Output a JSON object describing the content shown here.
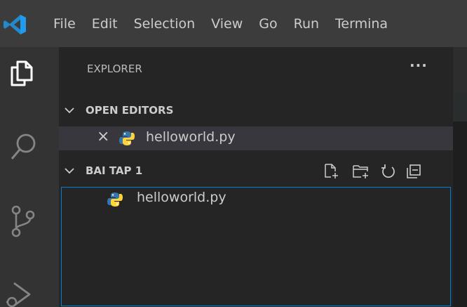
{
  "menu": {
    "items": [
      "File",
      "Edit",
      "Selection",
      "View",
      "Go",
      "Run",
      "Termina"
    ]
  },
  "activity_bar": {
    "icons": [
      "explorer-icon",
      "search-icon",
      "source-control-icon",
      "run-debug-icon"
    ]
  },
  "sidebar": {
    "title": "EXPLORER",
    "more_label": "···",
    "open_editors": {
      "header": "OPEN EDITORS",
      "items": [
        {
          "close": "×",
          "name": "helloworld.py"
        }
      ]
    },
    "folder": {
      "header": "BAI TAP 1",
      "toolbar": [
        "new-file-icon",
        "new-folder-icon",
        "refresh-icon",
        "collapse-all-icon"
      ],
      "files": [
        {
          "name": "helloworld.py"
        }
      ]
    }
  },
  "colors": {
    "titlebar": "#3c3c3c",
    "activitybar": "#333333",
    "sidebar": "#252526",
    "selected_row": "#37373d",
    "focus_border": "#007fd4",
    "vscode_blue": "#2489ca",
    "python_blue": "#3776ab",
    "python_yellow": "#ffd43b"
  }
}
